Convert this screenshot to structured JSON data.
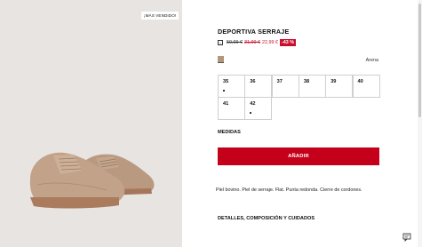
{
  "gallery": {
    "badge": "¡MÁS VENDIDO!",
    "image_alt": "Deportiva serraje"
  },
  "product": {
    "title": "DEPORTIVA SERRAJE",
    "info_icon": "info-icon",
    "price_original": "59,99 €",
    "price_previous": "31,99 €",
    "price_current": "22,99 €",
    "discount": "-43 %",
    "color_swatch": "#b3977b",
    "color_name": "Arena"
  },
  "sizes": [
    {
      "label": "35",
      "dot": true
    },
    {
      "label": "36",
      "dot": false
    },
    {
      "label": "37",
      "dot": false
    },
    {
      "label": "38",
      "dot": false
    },
    {
      "label": "39",
      "dot": false
    },
    {
      "label": "40",
      "dot": false
    },
    {
      "label": "41",
      "dot": false
    },
    {
      "label": "42",
      "dot": true
    }
  ],
  "measures_label": "MEDIDAS",
  "add_button": "AÑADIR",
  "description": "Piel bovino. Piel de serraje. Flat. Punta redonda. Cierre de cordones.",
  "details_label": "DETALLES, COMPOSICIÓN Y CUIDADOS",
  "colors": {
    "accent": "#c5001a",
    "sale": "#c8102e"
  }
}
